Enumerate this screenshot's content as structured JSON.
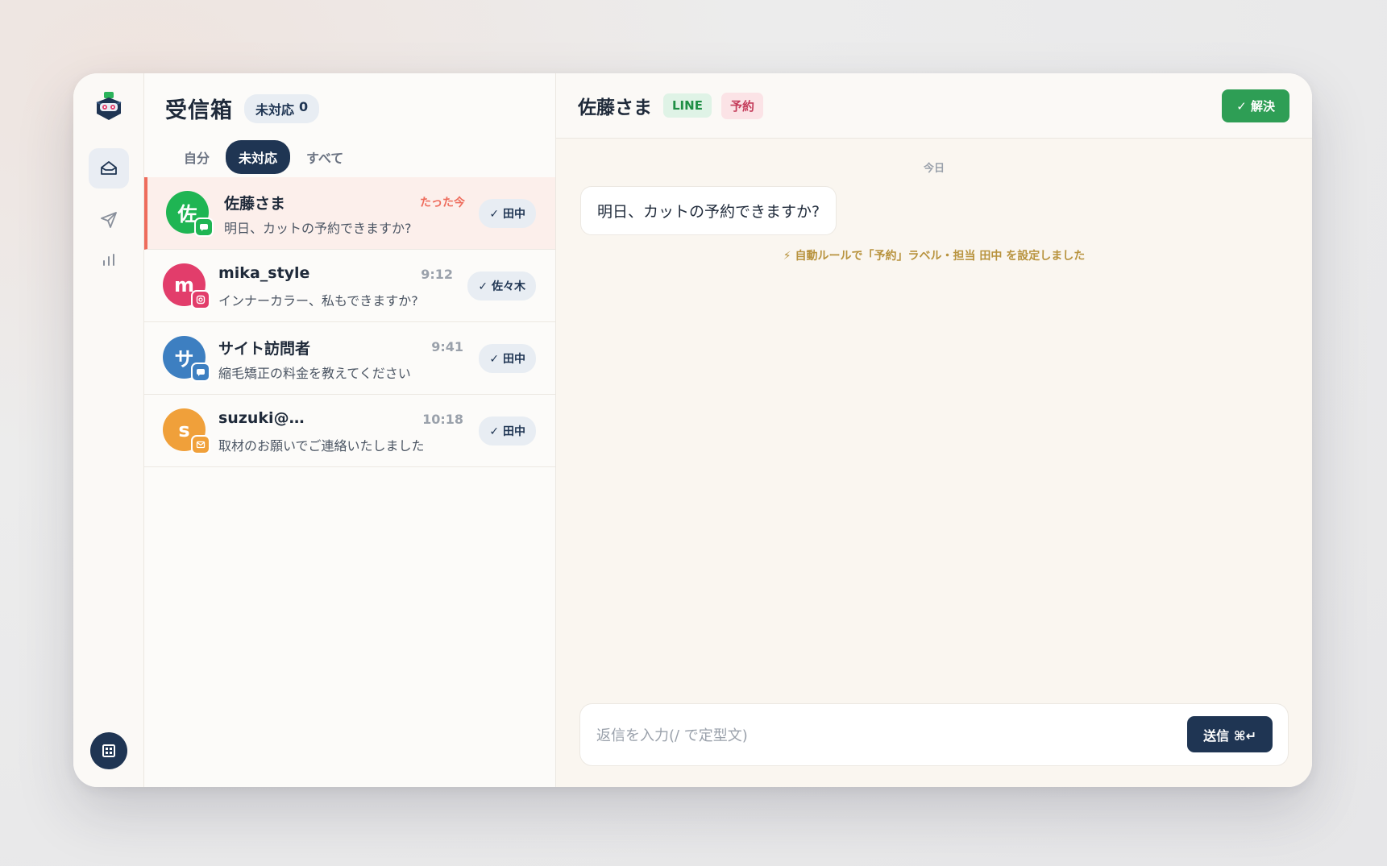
{
  "sidebar": {
    "logo_icon": "robot-box-logo",
    "nav": [
      {
        "icon": "inbox-icon",
        "active": true
      },
      {
        "icon": "send-icon",
        "active": false
      },
      {
        "icon": "bar-chart-icon",
        "active": false
      }
    ],
    "org_icon": "building-icon"
  },
  "inbox": {
    "title": "受信箱",
    "unhandled_label": "未対応",
    "unhandled_count": "0",
    "tabs": [
      {
        "label": "自分",
        "active": false
      },
      {
        "label": "未対応",
        "active": true
      },
      {
        "label": "すべて",
        "active": false
      }
    ],
    "conversations": [
      {
        "initial": "佐",
        "name": "佐藤さま",
        "time": "たった今",
        "preview": "明日、カットの予約できますか?",
        "assignee": "✓ 田中",
        "avatar_color": "#1fb553",
        "channel": "line",
        "channel_color": "#1fb553",
        "selected": true
      },
      {
        "initial": "m",
        "name": "mika_style",
        "time": "9:12",
        "preview": "インナーカラー、私もできますか?",
        "assignee": "✓ 佐々木",
        "avatar_color": "#e23d6b",
        "channel": "instagram",
        "channel_color": "#e23d6b",
        "selected": false
      },
      {
        "initial": "サ",
        "name": "サイト訪問者",
        "time": "9:41",
        "preview": "縮毛矯正の料金を教えてください",
        "assignee": "✓ 田中",
        "avatar_color": "#3d7fc1",
        "channel": "web-chat",
        "channel_color": "#3d7fc1",
        "selected": false
      },
      {
        "initial": "s",
        "name": "suzuki@…",
        "time": "10:18",
        "preview": "取材のお願いでご連絡いたしました",
        "assignee": "✓ 田中",
        "avatar_color": "#f0a03a",
        "channel": "email",
        "channel_color": "#f0a03a",
        "selected": false
      }
    ]
  },
  "chat": {
    "contact_name": "佐藤さま",
    "tags": [
      {
        "label": "LINE",
        "kind": "line"
      },
      {
        "label": "予約",
        "kind": "yoyaku"
      }
    ],
    "resolve_label": "✓ 解決",
    "date_label": "今日",
    "messages": [
      {
        "text": "明日、カットの予約できますか?"
      }
    ],
    "system_note": "⚡ 自動ルールで「予約」ラベル・担当 田中 を設定しました",
    "composer_placeholder": "返信を入力(/ で定型文)",
    "send_label": "送信 ⌘↵"
  }
}
